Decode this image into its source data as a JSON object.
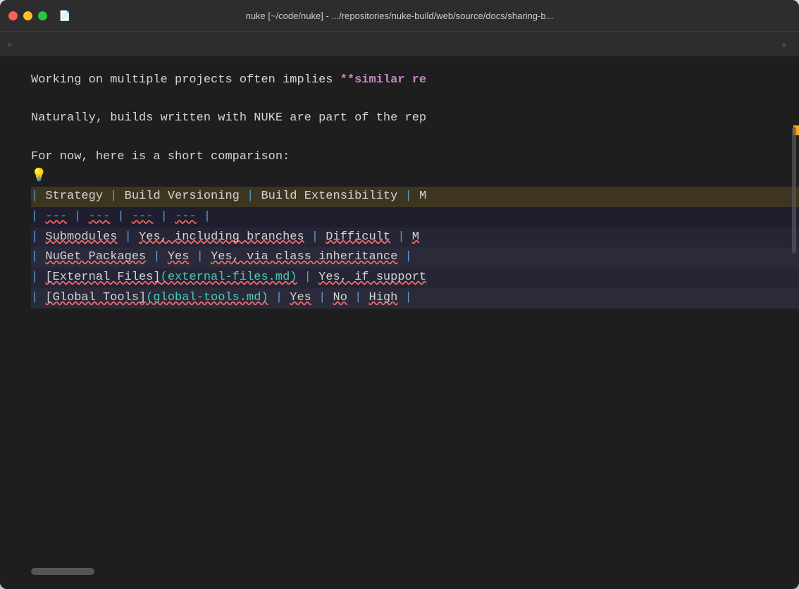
{
  "window": {
    "title": "nuke [~/code/nuke] - .../repositories/nuke-build/web/source/docs/sharing-b...",
    "traffic_lights": {
      "close_label": "close",
      "minimize_label": "minimize",
      "maximize_label": "maximize"
    }
  },
  "tab_bar": {
    "left_arrow": "»",
    "right_arrow": "»"
  },
  "editor": {
    "lines": [
      {
        "id": "line1",
        "content": "Working on multiple projects often implies **similar re"
      },
      {
        "id": "line2",
        "content": ""
      },
      {
        "id": "line3",
        "content": "Naturally, builds written with NUKE are part of the rep"
      },
      {
        "id": "line4",
        "content": ""
      },
      {
        "id": "line5",
        "content": "For now, here is a short comparison:"
      },
      {
        "id": "line6",
        "content": "💡"
      },
      {
        "id": "line7_header",
        "content": "| Strategy | Build Versioning | Build Extensibility | M"
      },
      {
        "id": "line8_sep",
        "content": "| --- | --- | --- | --- |"
      },
      {
        "id": "line9",
        "content": "| Submodules | Yes, including branches | Difficult | M"
      },
      {
        "id": "line10",
        "content": "| NuGet Packages | Yes | Yes, via class inheritance |"
      },
      {
        "id": "line11",
        "content": "| [External Files](external-files.md) | Yes, if support"
      },
      {
        "id": "line12",
        "content": "| [Global Tools](global-tools.md) | Yes | No | High |"
      }
    ]
  },
  "colors": {
    "bg": "#1e1e1e",
    "titlebar": "#2d2d2d",
    "text_normal": "#d4d4d4",
    "text_magenta": "#c586c0",
    "text_blue": "#569cd6",
    "text_cyan": "#4ec9b0",
    "text_header_bg": "#3d3520",
    "table_bg1": "#2a2a3a",
    "table_bg2": "#252535",
    "minimap_color": "#f5a623"
  }
}
